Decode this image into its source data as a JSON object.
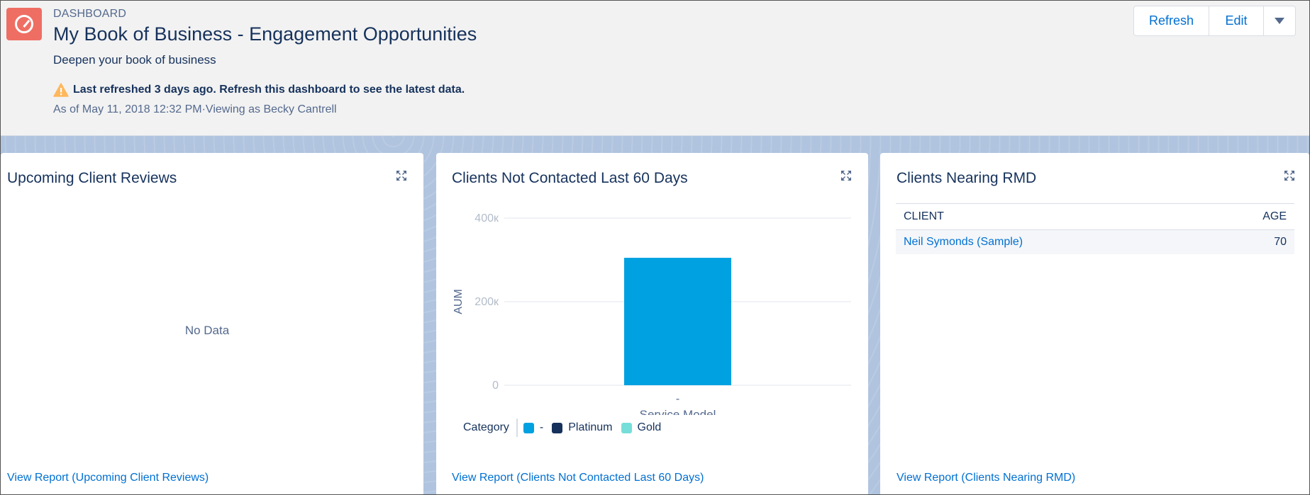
{
  "header": {
    "eyebrow": "DASHBOARD",
    "title": "My Book of Business - Engagement Opportunities",
    "subtitle": "Deepen your book of business",
    "warning": "Last refreshed 3 days ago. Refresh this dashboard to see the latest data.",
    "as_of": "As of May 11, 2018 12:32 PM·Viewing as Becky Cantrell"
  },
  "actions": {
    "refresh_label": "Refresh",
    "edit_label": "Edit",
    "more_icon": "chevron-down-icon"
  },
  "cards": [
    {
      "title": "Upcoming Client Reviews",
      "empty_text": "No Data",
      "link": "View Report (Upcoming Client Reviews)"
    },
    {
      "title": "Clients Not Contacted Last 60 Days",
      "link": "View Report (Clients Not Contacted Last 60 Days)"
    },
    {
      "title": "Clients Nearing RMD",
      "link": "View Report (Clients Nearing RMD)",
      "table": {
        "columns": [
          "CLIENT",
          "AGE"
        ],
        "rows": [
          {
            "client": "Neil Symonds (Sample)",
            "age": "70"
          }
        ]
      }
    }
  ],
  "colors": {
    "accent": "#0070d2",
    "bar": "#00a1e0",
    "platinum": "#16325c",
    "gold": "#76ded9",
    "app_icon": "#ef6e64",
    "warning": "#ffb75d"
  },
  "chart_data": {
    "type": "bar",
    "xlabel": "Service Model",
    "ylabel": "AUM",
    "ylim": [
      0,
      400000
    ],
    "y_ticks": [
      "0",
      "200к",
      "400к"
    ],
    "y_tick_values": [
      0,
      200000,
      400000
    ],
    "categories": [
      "-"
    ],
    "series": [
      {
        "name": "-",
        "values": [
          305000
        ]
      }
    ],
    "legend": {
      "title": "Category",
      "items": [
        {
          "name": "-",
          "color": "#00a1e0"
        },
        {
          "name": "Platinum",
          "color": "#16325c"
        },
        {
          "name": "Gold",
          "color": "#76ded9"
        }
      ],
      "placement": "bottom"
    },
    "grid": true
  }
}
